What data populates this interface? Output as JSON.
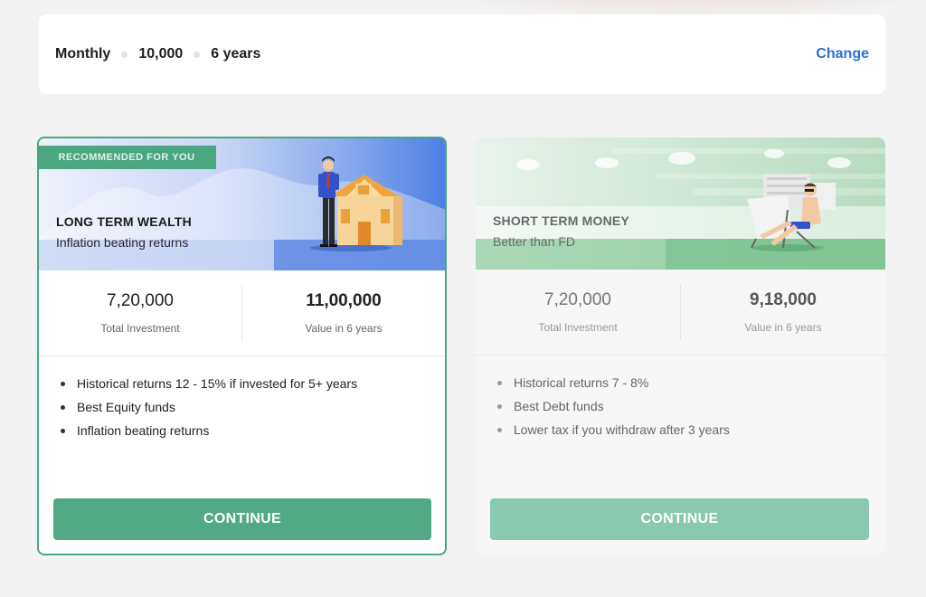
{
  "summary": {
    "frequency": "Monthly",
    "amount": "10,000",
    "duration": "6 years",
    "change_label": "Change"
  },
  "colors": {
    "accent_green": "#52a985",
    "link_blue": "#2f6fd6"
  },
  "plans": [
    {
      "ribbon": "RECOMMENDED FOR YOU",
      "title": "LONG TERM WEALTH",
      "subtitle": "Inflation beating returns",
      "investment_value": "7,20,000",
      "investment_label": "Total Investment",
      "future_value": "11,00,000",
      "future_label": "Value in 6 years",
      "bullets": [
        "Historical returns 12 - 15% if invested for 5+ years",
        "Best Equity funds",
        "Inflation beating returns"
      ],
      "cta": "CONTINUE",
      "illustration": "man-with-house-icon"
    },
    {
      "title": "SHORT TERM MONEY",
      "subtitle": "Better than FD",
      "investment_value": "7,20,000",
      "investment_label": "Total Investment",
      "future_value": "9,18,000",
      "future_label": "Value in 6 years",
      "bullets": [
        "Historical returns 7 - 8%",
        "Best Debt funds",
        "Lower tax if you withdraw after 3 years"
      ],
      "cta": "CONTINUE",
      "illustration": "man-on-beach-chair-icon"
    }
  ]
}
